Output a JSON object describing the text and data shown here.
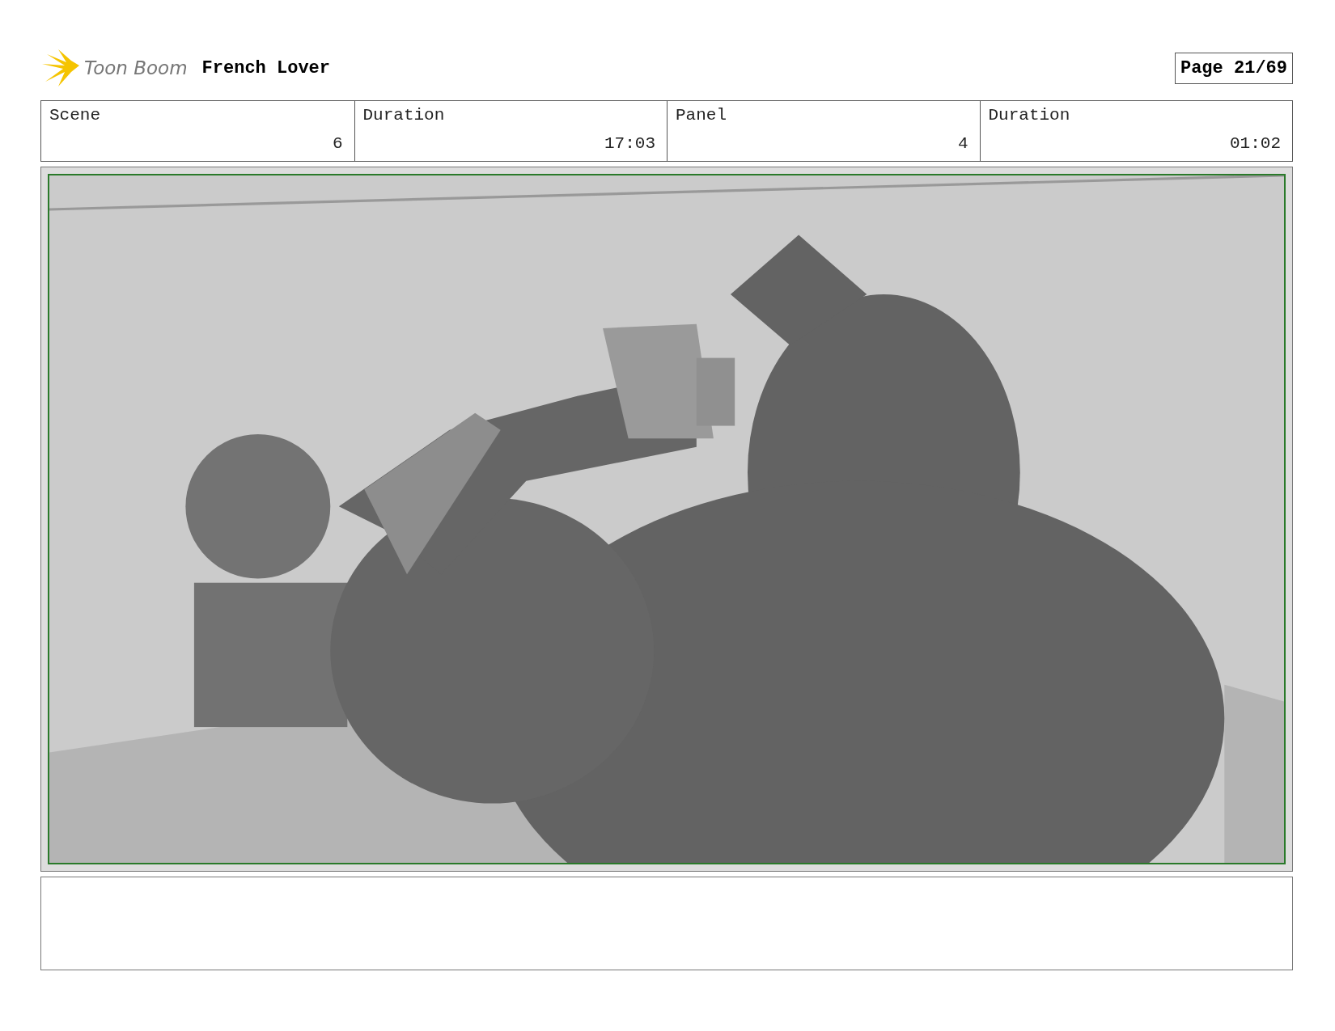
{
  "header": {
    "logo": "Toon Boom",
    "title": "French Lover",
    "page": "Page 21/69"
  },
  "fields": [
    {
      "label": "Scene",
      "value": "6"
    },
    {
      "label": "Duration",
      "value": "17:03"
    },
    {
      "label": "Panel",
      "value": "4"
    },
    {
      "label": "Duration",
      "value": "01:02"
    }
  ]
}
